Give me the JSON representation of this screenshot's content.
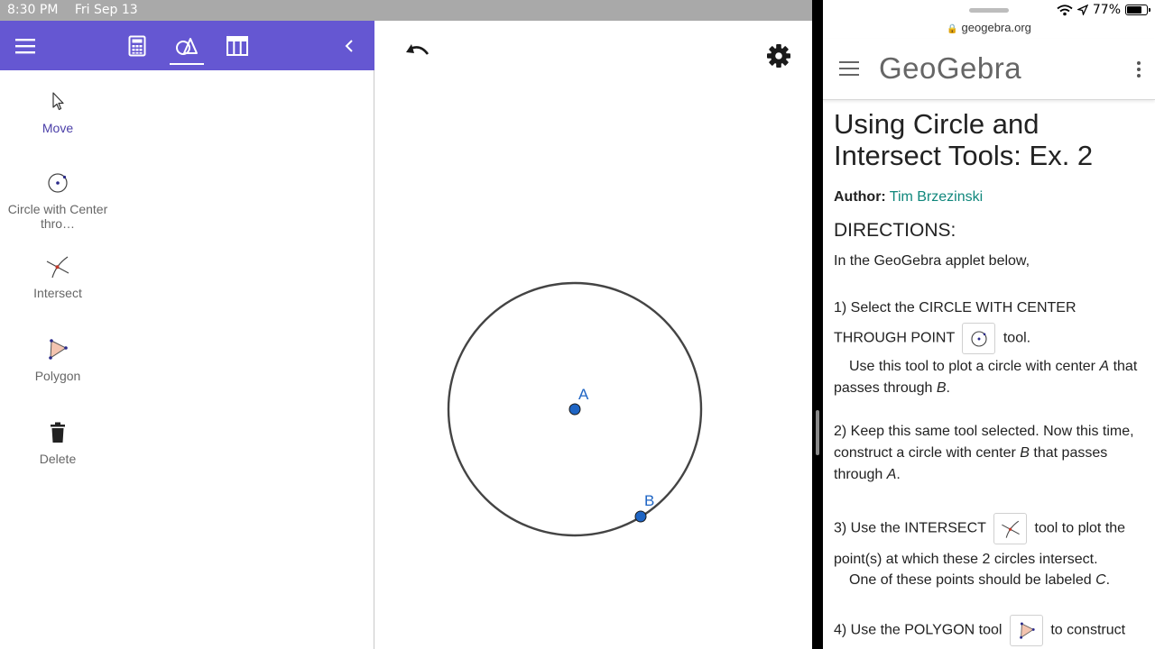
{
  "status_bar": {
    "time": "8:30 PM",
    "date": "Fri Sep 13"
  },
  "geogebra": {
    "toolbar": {
      "menu_icon": "hamburger-menu-icon",
      "tabs": [
        {
          "name": "algebra",
          "icon": "calculator-icon"
        },
        {
          "name": "tools",
          "icon": "geometry-tools-icon",
          "active": true
        },
        {
          "name": "table",
          "icon": "table-icon"
        }
      ],
      "collapse_icon": "chevron-left-icon"
    },
    "tools": [
      {
        "label": "Move",
        "icon": "cursor-arrow-icon",
        "active": true
      },
      {
        "label": "Circle with Center thro…",
        "icon": "circle-center-point-icon"
      },
      {
        "label": "Intersect",
        "icon": "intersect-icon"
      },
      {
        "label": "Polygon",
        "icon": "polygon-icon"
      },
      {
        "label": "Delete",
        "icon": "trash-icon"
      }
    ],
    "graphics": {
      "undo_icon": "undo-icon",
      "settings_icon": "gear-icon",
      "point_color": "#1f65c4",
      "points": [
        {
          "label": "A"
        },
        {
          "label": "B"
        }
      ]
    }
  },
  "browser": {
    "status_right": {
      "battery": "77%",
      "battery_level": 0.77
    },
    "url": "geogebra.org",
    "logo_text": "GeoGebra",
    "article": {
      "title": "Using Circle and Intersect Tools: Ex. 2",
      "author_label": "Author:",
      "author_name": "Tim Brzezinski",
      "directions_heading": "DIRECTIONS:",
      "intro": "In the GeoGebra applet below,",
      "step1_a": "1) Select the CIRCLE WITH CENTER THROUGH POINT",
      "step1_b": "tool.",
      "step1_c1": "Use this tool to plot a circle with center ",
      "step1_c_A": "A",
      "step1_c2": " that passes through ",
      "step1_c_B": "B",
      "step1_c3": ".",
      "step2_a": "2) Keep this same tool selected.  Now this time, construct a circle with center ",
      "step2_B": "B",
      "step2_b": " that passes through ",
      "step2_A": "A",
      "step2_c": ".",
      "step3_a": "3) Use the INTERSECT",
      "step3_b": "tool to plot the point(s) at which these 2 circles intersect.",
      "step3_c1": "One of these points should be labeled ",
      "step3_C": "C",
      "step3_c2": ".",
      "step4_a": "4) Use the POLYGON tool",
      "step4_b": "to construct"
    },
    "link_color": "#10877c"
  }
}
